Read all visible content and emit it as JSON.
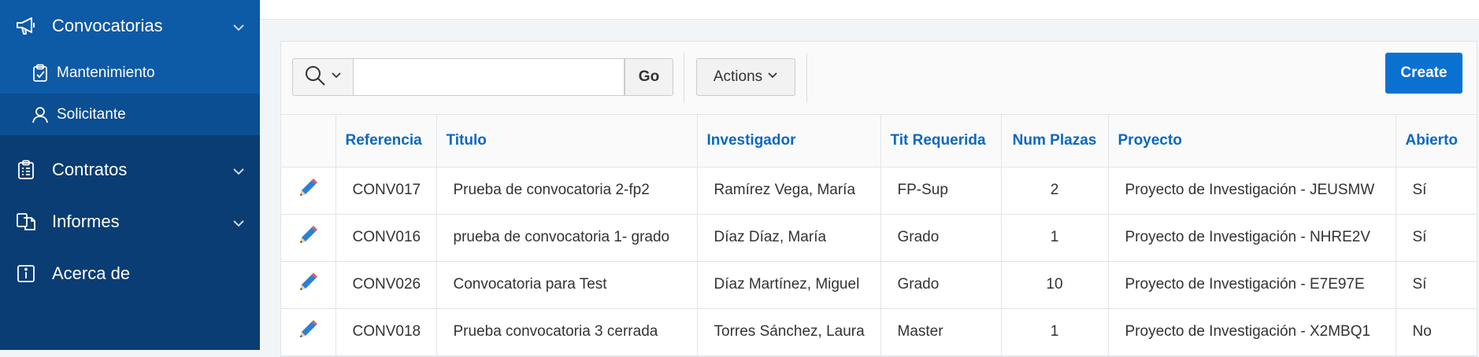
{
  "sidebar": {
    "items": [
      {
        "label": "Convocatorias",
        "icon": "megaphone-icon",
        "expanded": true,
        "children": [
          {
            "label": "Mantenimiento",
            "icon": "clipboard-icon",
            "active": true
          },
          {
            "label": "Solicitante",
            "icon": "user-icon",
            "active": false
          }
        ]
      },
      {
        "label": "Contratos",
        "icon": "clipboard-list-icon"
      },
      {
        "label": "Informes",
        "icon": "copy-documents-icon"
      },
      {
        "label": "Acerca de",
        "icon": "info-icon"
      }
    ]
  },
  "toolbar": {
    "search_value": "",
    "search_placeholder": "",
    "go_label": "Go",
    "actions_label": "Actions",
    "create_label": "Create"
  },
  "table": {
    "columns": [
      "Referencia",
      "Titulo",
      "Investigador",
      "Tit Requerida",
      "Num Plazas",
      "Proyecto",
      "Abierto"
    ],
    "rows": [
      [
        "CONV017",
        "Prueba de convocatoria 2-fp2",
        "Ramírez Vega, María",
        "FP-Sup",
        "2",
        "Proyecto de Investigación - JEUSMW",
        "Sí"
      ],
      [
        "CONV016",
        "prueba de convocatoria 1- grado",
        "Díaz Díaz, María",
        "Grado",
        "1",
        "Proyecto de Investigación - NHRE2V",
        "Sí"
      ],
      [
        "CONV026",
        "Convocatoria para Test",
        "Díaz Martínez, Miguel",
        "Grado",
        "10",
        "Proyecto de Investigación - E7E97E",
        "Sí"
      ],
      [
        "CONV018",
        "Prueba convocatoria 3 cerrada",
        "Torres Sánchez, Laura",
        "Master",
        "1",
        "Proyecto de Investigación - X2MBQ1",
        "No"
      ]
    ]
  },
  "colors": {
    "sidebar_bg": "#0a3d73",
    "sidebar_active": "#0d5aa7",
    "accent": "#0b71d1",
    "header_text": "#0b68c1"
  }
}
